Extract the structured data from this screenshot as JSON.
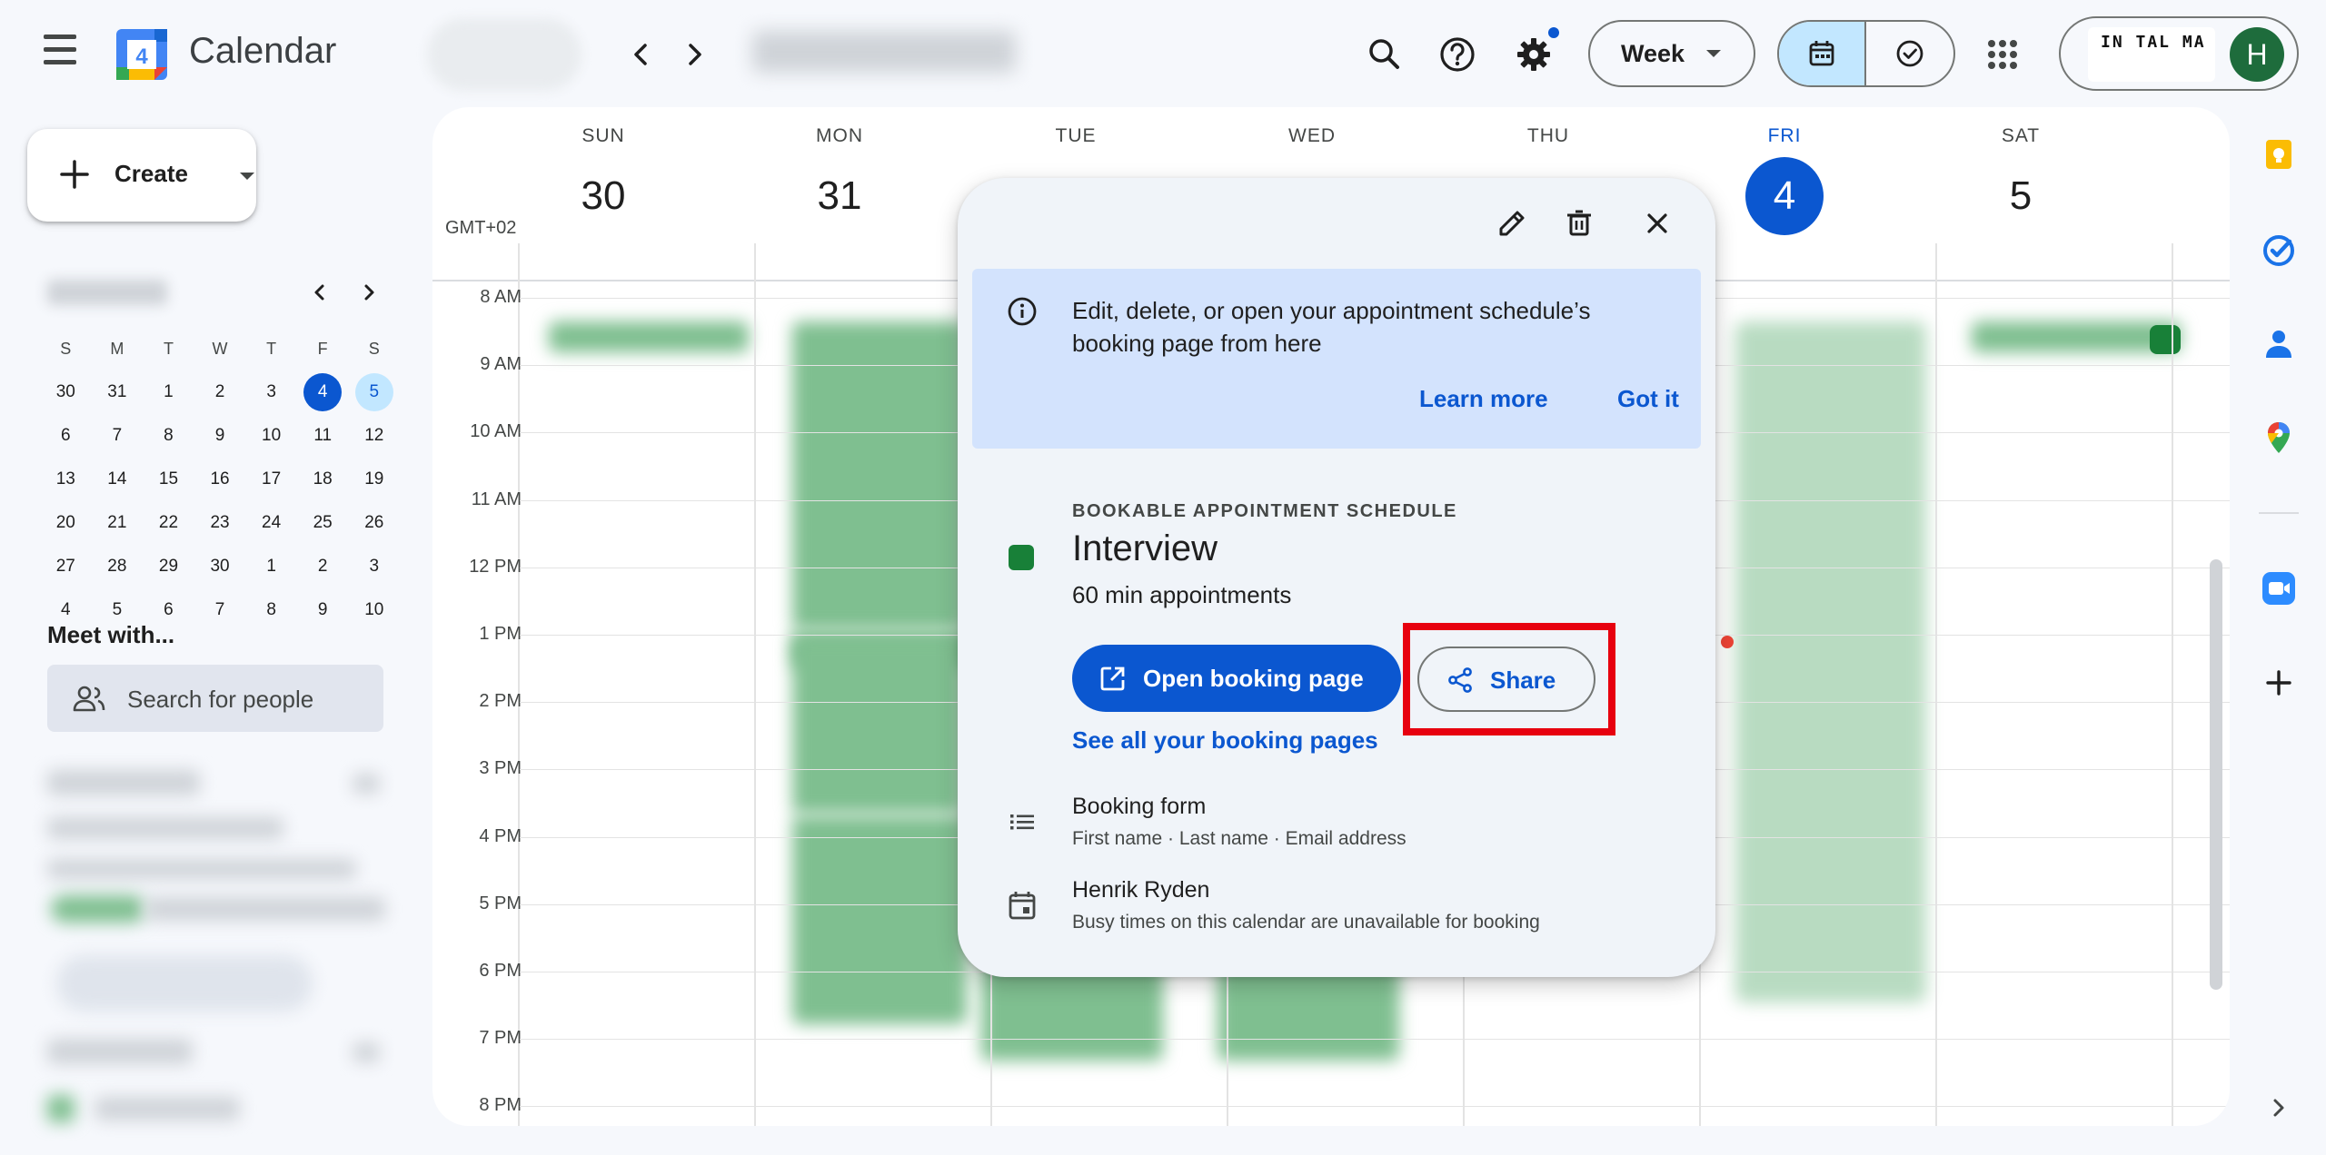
{
  "app": {
    "title": "Calendar",
    "logo_day": "4"
  },
  "header": {
    "view_select": "Week"
  },
  "org_logo_text": "IN TAL MA",
  "account": {
    "avatar_initial": "H"
  },
  "sidebar": {
    "create_label": "Create",
    "mini_calendar": {
      "weekday_heads": [
        "S",
        "M",
        "T",
        "W",
        "T",
        "F",
        "S"
      ],
      "weeks": [
        [
          "30",
          "31",
          "1",
          "2",
          "3",
          "4",
          "5"
        ],
        [
          "6",
          "7",
          "8",
          "9",
          "10",
          "11",
          "12"
        ],
        [
          "13",
          "14",
          "15",
          "16",
          "17",
          "18",
          "19"
        ],
        [
          "20",
          "21",
          "22",
          "23",
          "24",
          "25",
          "26"
        ],
        [
          "27",
          "28",
          "29",
          "30",
          "1",
          "2",
          "3"
        ],
        [
          "4",
          "5",
          "6",
          "7",
          "8",
          "9",
          "10"
        ]
      ]
    },
    "meet_with_title": "Meet with...",
    "search_people_placeholder": "Search for people"
  },
  "calendar": {
    "timezone": "GMT+02",
    "days": [
      {
        "dow": "SUN",
        "num": "30"
      },
      {
        "dow": "MON",
        "num": "31"
      },
      {
        "dow": "TUE",
        "num": ""
      },
      {
        "dow": "WED",
        "num": ""
      },
      {
        "dow": "THU",
        "num": ""
      },
      {
        "dow": "FRI",
        "num": "4"
      },
      {
        "dow": "SAT",
        "num": "5"
      }
    ],
    "hours": [
      "8 AM",
      "9 AM",
      "10 AM",
      "11 AM",
      "12 PM",
      "1 PM",
      "2 PM",
      "3 PM",
      "4 PM",
      "5 PM",
      "6 PM",
      "7 PM",
      "8 PM"
    ]
  },
  "popup": {
    "info_message": "Edit, delete, or open your appointment schedule’s booking page from here",
    "learn_more": "Learn more",
    "got_it": "Got it",
    "schedule_type": "BOOKABLE APPOINTMENT SCHEDULE",
    "title": "Interview",
    "subtitle": "60 min appointments",
    "open_booking_label": "Open booking page",
    "share_label": "Share",
    "see_all_label": "See all your booking pages",
    "booking_form_title": "Booking form",
    "booking_form_fields": "First name · Last name · Email address",
    "owner_name": "Henrik Ryden",
    "owner_note": "Busy times on this calendar are unavailable for booking"
  },
  "colors": {
    "accent": "#0b57d0",
    "schedule_color": "#188038",
    "highlight": "#e7000f"
  }
}
